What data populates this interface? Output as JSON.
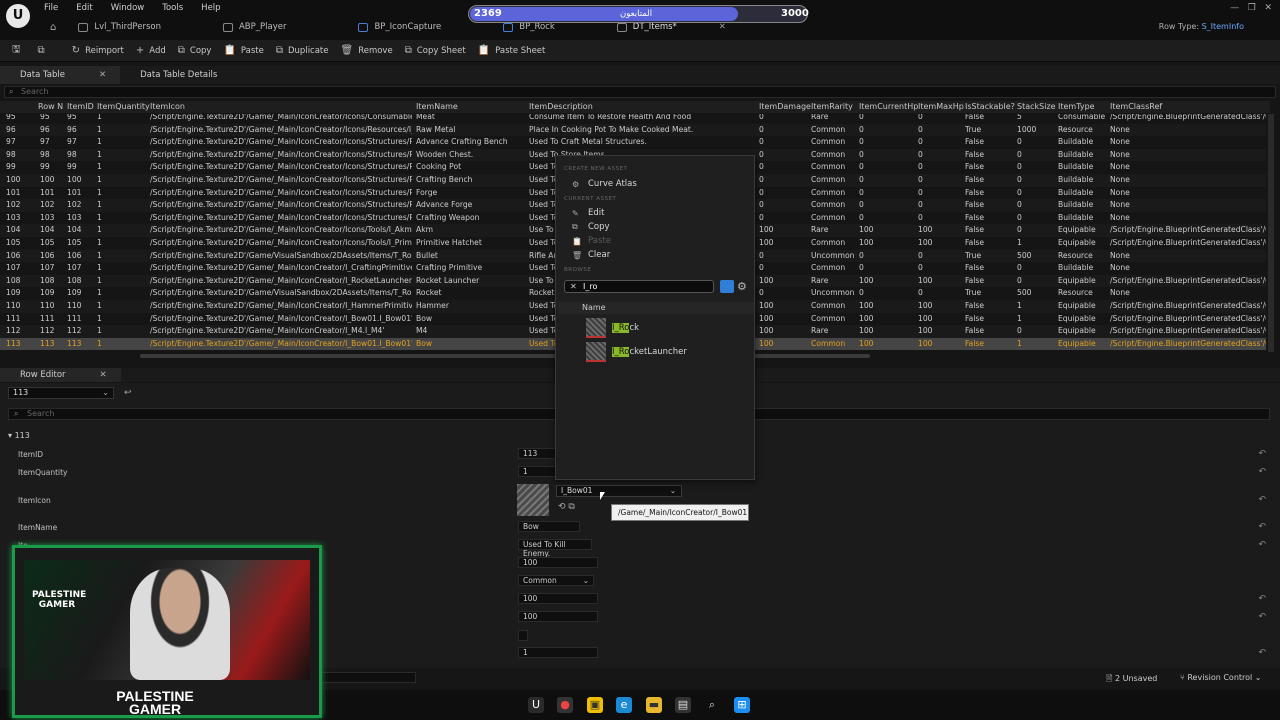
{
  "menu": [
    "File",
    "Edit",
    "Window",
    "Tools",
    "Help"
  ],
  "tabs": [
    {
      "label": "Lvl_ThirdPerson",
      "icon": "level-icon"
    },
    {
      "label": "ABP_Player",
      "icon": "anim-blueprint-icon"
    },
    {
      "label": "BP_IconCapture",
      "icon": "blueprint-icon"
    },
    {
      "label": "BP_Rock",
      "icon": "blueprint-icon"
    },
    {
      "label": "DT_Items*",
      "icon": "data-table-icon"
    }
  ],
  "stream": {
    "left": "2369",
    "middle": "المتابعون",
    "right": "3000",
    "progress": 0.78
  },
  "row_type": {
    "label": "Row Type:",
    "value": "S_ItemInfo"
  },
  "toolbar": [
    "Reimport",
    "Add",
    "Copy",
    "Paste",
    "Duplicate",
    "Remove",
    "Copy Sheet",
    "Paste Sheet"
  ],
  "panel_tabs": {
    "data_table": "Data Table",
    "details": "Data Table Details",
    "row_editor": "Row Editor"
  },
  "table": {
    "search_placeholder": "Search",
    "columns": [
      "Row N",
      "ItemID",
      "ItemQuantity",
      "ItemIcon",
      "ItemName",
      "ItemDescription",
      "ItemDamage",
      "ItemRarity",
      "ItemCurrentHp",
      "ItemMaxHp",
      "IsStackable?",
      "StackSize",
      "ItemType",
      "ItemClassRef"
    ],
    "rows": [
      [
        "95",
        "95",
        "1",
        "/Script/Engine.Texture2D'/Game/_Main/IconCreator/Icons/Consumables",
        "Meat",
        "Consume Item To Restore Health And Food",
        "0",
        "Rare",
        "0",
        "0",
        "False",
        "5",
        "Consumable",
        "/Script/Engine.BlueprintGeneratedClass'/G"
      ],
      [
        "96",
        "96",
        "1",
        "/Script/Engine.Texture2D'/Game/_Main/IconCreator/Icons/Resources/I_R",
        "Raw Metal",
        "Place In Cooking Pot To Make Cooked Meat.",
        "0",
        "Common",
        "0",
        "0",
        "True",
        "1000",
        "Resource",
        "None"
      ],
      [
        "97",
        "97",
        "1",
        "/Script/Engine.Texture2D'/Game/_Main/IconCreator/Icons/Structures/Pl",
        "Advance Crafting Bench",
        "Used To Craft Metal Structures.",
        "0",
        "Common",
        "0",
        "0",
        "False",
        "0",
        "Buildable",
        "None"
      ],
      [
        "98",
        "98",
        "1",
        "/Script/Engine.Texture2D'/Game/_Main/IconCreator/Icons/Structures/Pl",
        "Wooden Chest.",
        "Used To Store Items",
        "0",
        "Common",
        "0",
        "0",
        "False",
        "0",
        "Buildable",
        "None"
      ],
      [
        "99",
        "99",
        "1",
        "/Script/Engine.Texture2D'/Game/_Main/IconCreator/Icons/Structures/Pl",
        "Cooking Pot",
        "Used To",
        "0",
        "Common",
        "0",
        "0",
        "False",
        "0",
        "Buildable",
        "None"
      ],
      [
        "100",
        "100",
        "1",
        "/Script/Engine.Texture2D'/Game/_Main/IconCreator/Icons/Structures/Pl",
        "Crafting Bench",
        "Used To",
        "0",
        "Common",
        "0",
        "0",
        "False",
        "0",
        "Buildable",
        "None"
      ],
      [
        "101",
        "101",
        "1",
        "/Script/Engine.Texture2D'/Game/_Main/IconCreator/Icons/Structures/Pl",
        "Forge",
        "Used To",
        "0",
        "Common",
        "0",
        "0",
        "False",
        "0",
        "Buildable",
        "None"
      ],
      [
        "102",
        "102",
        "1",
        "/Script/Engine.Texture2D'/Game/_Main/IconCreator/Icons/Structures/Pl",
        "Advance Forge",
        "Used To",
        "0",
        "Common",
        "0",
        "0",
        "False",
        "0",
        "Buildable",
        "None"
      ],
      [
        "103",
        "103",
        "1",
        "/Script/Engine.Texture2D'/Game/_Main/IconCreator/Icons/Structures/Pl",
        "Crafting Weapon",
        "Used To",
        "0",
        "Common",
        "0",
        "0",
        "False",
        "0",
        "Buildable",
        "None"
      ],
      [
        "104",
        "104",
        "1",
        "/Script/Engine.Texture2D'/Game/_Main/IconCreator/Icons/Tools/I_Akm.I",
        "Akm",
        "Use To",
        "100",
        "Rare",
        "100",
        "100",
        "False",
        "0",
        "Equipable",
        "/Script/Engine.BlueprintGeneratedClass'/G"
      ],
      [
        "105",
        "105",
        "1",
        "/Script/Engine.Texture2D'/Game/_Main/IconCreator/Icons/Tools/I_Primi",
        "Primitive Hatchet",
        "Used To",
        "100",
        "Common",
        "100",
        "100",
        "False",
        "1",
        "Equipable",
        "/Script/Engine.BlueprintGeneratedClass'/G"
      ],
      [
        "106",
        "106",
        "1",
        "/Script/Engine.Texture2D'/Game/VisualSandbox/2DAssets/Items/T_Rou",
        "Bullet",
        "Rifle Am",
        "0",
        "Uncommon",
        "0",
        "0",
        "True",
        "500",
        "Resource",
        "None"
      ],
      [
        "107",
        "107",
        "1",
        "/Script/Engine.Texture2D'/Game/_Main/IconCreator/I_CraftingPrimitive.I",
        "Crafting Primitive",
        "Used To",
        "0",
        "Common",
        "0",
        "0",
        "False",
        "0",
        "Buildable",
        "None"
      ],
      [
        "108",
        "108",
        "1",
        "/Script/Engine.Texture2D'/Game/_Main/IconCreator/I_RocketLauncher.I_",
        "Rocket Launcher",
        "Use To",
        "100",
        "Rare",
        "100",
        "100",
        "False",
        "0",
        "Equipable",
        "/Script/Engine.BlueprintGeneratedClass'/G"
      ],
      [
        "109",
        "109",
        "1",
        "/Script/Engine.Texture2D'/Game/VisualSandbox/2DAssets/Items/T_Rou",
        "Rocket",
        "Rocket",
        "0",
        "Uncommon",
        "0",
        "0",
        "True",
        "500",
        "Resource",
        "None"
      ],
      [
        "110",
        "110",
        "1",
        "/Script/Engine.Texture2D'/Game/_Main/IconCreator/I_HammerPrimitive.I_",
        "Hammer",
        "Used To",
        "100",
        "Common",
        "100",
        "100",
        "False",
        "1",
        "Equipable",
        "/Script/Engine.BlueprintGeneratedClass'/G"
      ],
      [
        "111",
        "111",
        "1",
        "/Script/Engine.Texture2D'/Game/_Main/IconCreator/I_Bow01.I_Bow01'",
        "Bow",
        "Used To",
        "100",
        "Common",
        "100",
        "100",
        "False",
        "1",
        "Equipable",
        "/Script/Engine.BlueprintGeneratedClass'/G"
      ],
      [
        "112",
        "112",
        "1",
        "/Script/Engine.Texture2D'/Game/_Main/IconCreator/I_M4.I_M4'",
        "M4",
        "Used To",
        "100",
        "Rare",
        "100",
        "100",
        "False",
        "0",
        "Equipable",
        "/Script/Engine.BlueprintGeneratedClass'/G"
      ],
      [
        "113",
        "113",
        "1",
        "/Script/Engine.Texture2D'/Game/_Main/IconCreator/I_Bow01.I_Bow01'",
        "Bow",
        "Used To",
        "100",
        "Common",
        "100",
        "100",
        "False",
        "1",
        "Equipable",
        "/Script/Engine.BlueprintGeneratedClass'/G"
      ]
    ]
  },
  "row_editor": {
    "selected_row": "113",
    "search_placeholder": "Search",
    "group": "113",
    "props": {
      "id": "ItemID",
      "qty": "ItemQuantity",
      "icon": "ItemIcon",
      "name": "ItemName",
      "cut": "Ite"
    },
    "values": {
      "id": "113",
      "qty": "1",
      "name": "Bow",
      "desc": "Used To Kill Enemy.",
      "damage": "100",
      "rarity": "Common",
      "hp": "100",
      "maxhp": "100",
      "stack": "1"
    },
    "icon_asset": "I_Bow01",
    "tooltip": "/Game/_Main/IconCreator/I_Bow01"
  },
  "popup": {
    "sec_create": "CREATE NEW ASSET",
    "curve_atlas": "Curve Atlas",
    "sec_current": "CURRENT ASSET",
    "edit": "Edit",
    "copy": "Copy",
    "paste": "Paste",
    "clear": "Clear",
    "sec_browse": "BROWSE",
    "search_value": "I_ro",
    "list_header": "Name",
    "assets": [
      {
        "hl": "I_Ro",
        "rest": "ck"
      },
      {
        "hl": "I_Ro",
        "rest": "cketLauncher"
      }
    ]
  },
  "status": {
    "unsaved": "2 Unsaved",
    "revision": "Revision Control"
  },
  "webcam": {
    "logo": "PALESTINE GAMER",
    "banner_top": "PALESTINE",
    "banner_bottom": "GAMER"
  }
}
